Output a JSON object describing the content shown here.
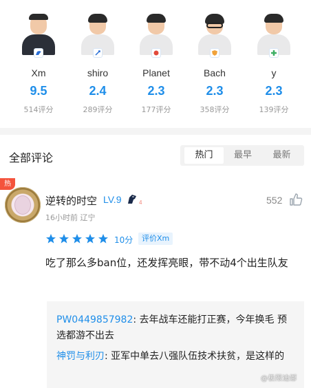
{
  "players": [
    {
      "name": "Xm",
      "score": "9.5",
      "count": "514评分",
      "badge_icon": "liquid-horse-icon",
      "badge_color": "#2a6fd6"
    },
    {
      "name": "shiro",
      "score": "2.4",
      "count": "289评分",
      "badge_icon": "sword-icon",
      "badge_color": "#2a6fd6"
    },
    {
      "name": "Planet",
      "score": "2.3",
      "count": "177评分",
      "badge_icon": "tiger-icon",
      "badge_color": "#e24a3b"
    },
    {
      "name": "Bach",
      "score": "2.3",
      "count": "358评分",
      "badge_icon": "shield-icon",
      "badge_color": "#f0a23a"
    },
    {
      "name": "y",
      "score": "2.3",
      "count": "139评分",
      "badge_icon": "cross-icon",
      "badge_color": "#3cae63"
    }
  ],
  "comments_section": {
    "title": "全部评论",
    "tabs": [
      {
        "label": "热门",
        "active": true
      },
      {
        "label": "最早",
        "active": false
      },
      {
        "label": "最新",
        "active": false
      }
    ]
  },
  "comment": {
    "hot_badge": "热",
    "user_name": "逆转的时空",
    "level": "LV.9",
    "team_tag": "4",
    "likes": "552",
    "meta": "16小时前  辽宁",
    "rating_value": 5,
    "rating_score": "10分",
    "rating_target": "评价Xm",
    "text": "吃了那么多ban位，还发挥亮眼，带不动4个出生队友",
    "replies": [
      {
        "user": "PW0449857982",
        "separator": ": ",
        "text": "去年战车还能打正赛，今年换毛 预选都游不出去"
      },
      {
        "user": "神罚与利刃",
        "separator": ": ",
        "text": "亚军中单去八强队伍技术扶贫，是这样的"
      }
    ]
  },
  "watermark": "@极限迪娜",
  "colors": {
    "accent": "#1f8ee9",
    "hot": "#f4533c"
  }
}
